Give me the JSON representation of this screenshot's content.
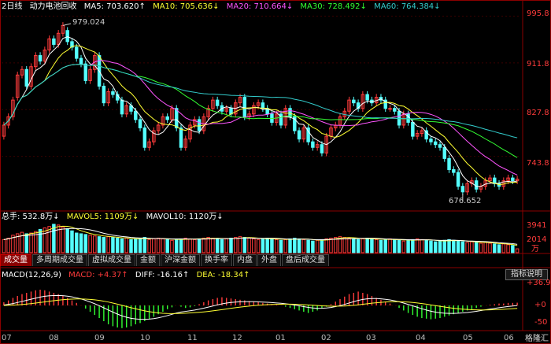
{
  "header": {
    "period": "2日线",
    "name": "动力电池回收",
    "ma5": "MA5: 703.620↑",
    "ma10": "MA10: 705.636↓",
    "ma20": "MA20: 710.664↓",
    "ma30": "MA30: 728.492↓",
    "ma60": "MA60: 764.384↓"
  },
  "colors": {
    "up": "#ff3b3b",
    "down": "#54ffff",
    "ma5": "#ffffff",
    "ma10": "#ffff33",
    "ma20": "#ff55ff",
    "ma30": "#33ff33",
    "ma60": "#33cccc"
  },
  "price_axis": [
    "995.8",
    "911.8",
    "827.8",
    "743.8"
  ],
  "annotations": {
    "high": "979.024",
    "low": "676.652"
  },
  "volume": {
    "total": "总手: 532.8万↓",
    "mavol5": "MAVOL5: 1109万↓",
    "mavol10": "MAVOL10: 1120万↓",
    "axis": [
      "3941",
      "2014",
      "万"
    ]
  },
  "tabs": [
    "成交量",
    "多周期成交量",
    "虚拟成交量",
    "金额",
    "沪深金额",
    "换手率",
    "内盘",
    "外盘",
    "盘后成交量"
  ],
  "macd": {
    "title": "MACD(12,26,9)",
    "macd": "MACD: +4.37↑",
    "diff": "DIFF: -16.16↑",
    "dea": "DEA: -18.34↑",
    "axis": [
      "+36.98",
      "+0",
      "-50"
    ],
    "button": "指标说明"
  },
  "x_labels": [
    "07",
    "08",
    "09",
    "10",
    "11",
    "12",
    "01",
    "02",
    "03",
    "04",
    "05",
    "06"
  ],
  "logo": "格隆汇",
  "chart_data": {
    "type": "candlestick",
    "title": "动力电池回收",
    "ylim": [
      650,
      1005
    ],
    "price_axis": [
      995.8,
      911.8,
      827.8,
      743.8
    ],
    "high": 979.024,
    "low": 676.652,
    "months": [
      "07",
      "08",
      "09",
      "10",
      "11",
      "12",
      "01",
      "02",
      "03",
      "04",
      "05",
      "06"
    ],
    "closes": [
      800,
      815,
      845,
      890,
      900,
      870,
      905,
      925,
      915,
      935,
      955,
      945,
      965,
      979,
      950,
      940,
      920,
      910,
      880,
      900,
      925,
      870,
      840,
      860,
      855,
      845,
      820,
      835,
      825,
      810,
      795,
      760,
      770,
      790,
      800,
      815,
      810,
      830,
      795,
      760,
      775,
      800,
      810,
      790,
      815,
      830,
      845,
      835,
      825,
      830,
      820,
      840,
      850,
      815,
      820,
      835,
      840,
      830,
      820,
      805,
      820,
      800,
      830,
      815,
      790,
      775,
      795,
      770,
      760,
      765,
      750,
      780,
      795,
      800,
      815,
      825,
      845,
      840,
      830,
      855,
      845,
      840,
      850,
      845,
      830,
      830,
      825,
      800,
      820,
      805,
      780,
      785,
      790,
      775,
      770,
      765,
      760,
      740,
      720,
      715,
      690,
      680,
      695,
      700,
      685,
      690,
      700,
      705,
      695,
      690,
      700,
      705,
      700,
      703
    ],
    "opens": [
      780,
      800,
      815,
      850,
      890,
      900,
      870,
      905,
      925,
      915,
      935,
      955,
      945,
      965,
      970,
      950,
      940,
      920,
      910,
      880,
      900,
      925,
      870,
      840,
      860,
      855,
      845,
      820,
      835,
      825,
      810,
      795,
      760,
      770,
      790,
      800,
      815,
      810,
      830,
      795,
      760,
      775,
      800,
      810,
      790,
      815,
      830,
      845,
      835,
      825,
      830,
      820,
      840,
      850,
      815,
      820,
      835,
      840,
      830,
      820,
      805,
      820,
      800,
      830,
      815,
      790,
      775,
      795,
      770,
      760,
      765,
      750,
      780,
      795,
      800,
      815,
      825,
      845,
      840,
      830,
      855,
      845,
      840,
      850,
      845,
      830,
      830,
      825,
      800,
      820,
      805,
      780,
      785,
      790,
      775,
      770,
      765,
      760,
      740,
      720,
      715,
      690,
      680,
      695,
      700,
      685,
      690,
      700,
      705,
      695,
      690,
      700,
      705,
      700
    ],
    "volume": [
      1800,
      2000,
      2400,
      2600,
      2800,
      2600,
      2700,
      2900,
      3200,
      3400,
      3600,
      3900,
      3800,
      3500,
      3300,
      3000,
      2700,
      2600,
      2500,
      2400,
      2300,
      2200,
      2100,
      2200,
      2100,
      2000,
      1900,
      2000,
      1800,
      1900,
      2000,
      2100,
      1800,
      1900,
      2000,
      1900,
      1800,
      1700,
      1800,
      1900,
      2000,
      1900,
      1800,
      1900,
      2000,
      2100,
      2000,
      1900,
      1800,
      1900,
      2000,
      2100,
      2200,
      2100,
      2000,
      1900,
      1800,
      1900,
      2000,
      1900,
      1800,
      1700,
      1800,
      1900,
      2000,
      1900,
      1800,
      1700,
      1600,
      1700,
      1800,
      1900,
      2000,
      2100,
      2200,
      2100,
      2000,
      1900,
      1800,
      1900,
      2000,
      1900,
      1800,
      1700,
      1800,
      1900,
      1800,
      1700,
      1600,
      1700,
      1800,
      1900,
      1800,
      1700,
      1600,
      1500,
      1600,
      1700,
      1800,
      1700,
      1600,
      1500,
      1400,
      1500,
      1400,
      1300,
      1400,
      1300,
      1200,
      1100,
      1200,
      1100,
      1000,
      533
    ],
    "macd_hist": [
      5,
      8,
      12,
      15,
      18,
      20,
      22,
      24,
      25,
      24,
      22,
      20,
      18,
      15,
      12,
      8,
      4,
      0,
      -5,
      -10,
      -15,
      -20,
      -25,
      -30,
      -33,
      -35,
      -36,
      -35,
      -33,
      -30,
      -28,
      -25,
      -22,
      -18,
      -14,
      -10,
      -6,
      -3,
      0,
      -2,
      -4,
      -3,
      -1,
      2,
      5,
      8,
      10,
      12,
      13,
      12,
      11,
      10,
      9,
      8,
      7,
      6,
      5,
      4,
      3,
      2,
      1,
      0,
      -2,
      -4,
      -6,
      -8,
      -10,
      -12,
      -10,
      -8,
      -5,
      -2,
      2,
      6,
      10,
      14,
      18,
      20,
      22,
      20,
      18,
      15,
      12,
      9,
      6,
      3,
      0,
      -4,
      -8,
      -12,
      -15,
      -18,
      -20,
      -21,
      -22,
      -21,
      -20,
      -18,
      -16,
      -14,
      -12,
      -10,
      -8,
      -6,
      -4,
      -2,
      0,
      1,
      2,
      3,
      3,
      4,
      4,
      4.37
    ]
  }
}
